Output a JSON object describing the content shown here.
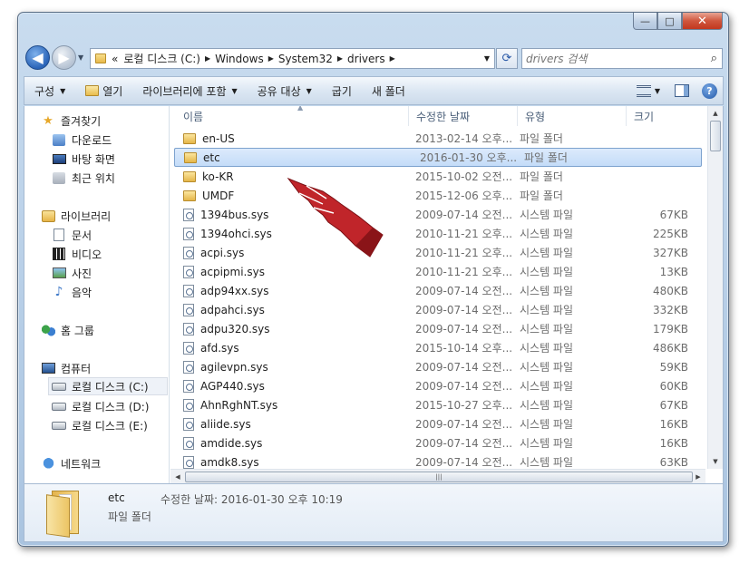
{
  "window": {
    "close_glyph": "✕",
    "minimize_glyph": "—",
    "maximize_glyph": "□"
  },
  "nav": {
    "back_glyph": "◀",
    "forward_glyph": "▶",
    "address": {
      "prefix": "«",
      "segments": [
        "로컬 디스크 (C:)",
        "Windows",
        "System32",
        "drivers"
      ]
    },
    "search_placeholder": "drivers 검색"
  },
  "toolbar": {
    "items": [
      {
        "label": "구성",
        "dropdown": true
      },
      {
        "label": "열기",
        "dropdown": false,
        "icon": "open-folder-icon"
      },
      {
        "label": "라이브러리에 포함",
        "dropdown": true
      },
      {
        "label": "공유 대상",
        "dropdown": true
      },
      {
        "label": "굽기",
        "dropdown": false
      },
      {
        "label": "새 폴더",
        "dropdown": false
      }
    ],
    "help_glyph": "?"
  },
  "sidebar": {
    "favorites": {
      "label": "즐겨찾기",
      "items": [
        "다운로드",
        "바탕 화면",
        "최근 위치"
      ]
    },
    "libraries": {
      "label": "라이브러리",
      "items": [
        "문서",
        "비디오",
        "사진",
        "음악"
      ]
    },
    "homegroup": {
      "label": "홈 그룹"
    },
    "computer": {
      "label": "컴퓨터",
      "items": [
        "로컬 디스크 (C:)",
        "로컬 디스크 (D:)",
        "로컬 디스크 (E:)"
      ],
      "selected": "로컬 디스크 (C:)"
    },
    "network": {
      "label": "네트워크"
    }
  },
  "columns": {
    "name": "이름",
    "date": "수정한 날짜",
    "type": "유형",
    "size": "크기"
  },
  "files": [
    {
      "name": "en-US",
      "date": "2013-02-14 오후...",
      "type": "파일 폴더",
      "size": "",
      "kind": "folder"
    },
    {
      "name": "etc",
      "date": "2016-01-30 오후...",
      "type": "파일 폴더",
      "size": "",
      "kind": "folder",
      "selected": true
    },
    {
      "name": "ko-KR",
      "date": "2015-10-02 오전...",
      "type": "파일 폴더",
      "size": "",
      "kind": "folder"
    },
    {
      "name": "UMDF",
      "date": "2015-12-06 오후...",
      "type": "파일 폴더",
      "size": "",
      "kind": "folder"
    },
    {
      "name": "1394bus.sys",
      "date": "2009-07-14 오전...",
      "type": "시스템 파일",
      "size": "67KB",
      "kind": "sys"
    },
    {
      "name": "1394ohci.sys",
      "date": "2010-11-21 오후...",
      "type": "시스템 파일",
      "size": "225KB",
      "kind": "sys"
    },
    {
      "name": "acpi.sys",
      "date": "2010-11-21 오후...",
      "type": "시스템 파일",
      "size": "327KB",
      "kind": "sys"
    },
    {
      "name": "acpipmi.sys",
      "date": "2010-11-21 오후...",
      "type": "시스템 파일",
      "size": "13KB",
      "kind": "sys"
    },
    {
      "name": "adp94xx.sys",
      "date": "2009-07-14 오전...",
      "type": "시스템 파일",
      "size": "480KB",
      "kind": "sys"
    },
    {
      "name": "adpahci.sys",
      "date": "2009-07-14 오전...",
      "type": "시스템 파일",
      "size": "332KB",
      "kind": "sys"
    },
    {
      "name": "adpu320.sys",
      "date": "2009-07-14 오전...",
      "type": "시스템 파일",
      "size": "179KB",
      "kind": "sys"
    },
    {
      "name": "afd.sys",
      "date": "2015-10-14 오후...",
      "type": "시스템 파일",
      "size": "486KB",
      "kind": "sys"
    },
    {
      "name": "agilevpn.sys",
      "date": "2009-07-14 오전...",
      "type": "시스템 파일",
      "size": "59KB",
      "kind": "sys"
    },
    {
      "name": "AGP440.sys",
      "date": "2009-07-14 오전...",
      "type": "시스템 파일",
      "size": "60KB",
      "kind": "sys"
    },
    {
      "name": "AhnRghNT.sys",
      "date": "2015-10-27 오후...",
      "type": "시스템 파일",
      "size": "67KB",
      "kind": "sys"
    },
    {
      "name": "aliide.sys",
      "date": "2009-07-14 오전...",
      "type": "시스템 파일",
      "size": "16KB",
      "kind": "sys"
    },
    {
      "name": "amdide.sys",
      "date": "2009-07-14 오전...",
      "type": "시스템 파일",
      "size": "16KB",
      "kind": "sys"
    },
    {
      "name": "amdk8.sys",
      "date": "2009-07-14 오전...",
      "type": "시스템 파일",
      "size": "63KB",
      "kind": "sys"
    }
  ],
  "details": {
    "name": "etc",
    "type": "파일 폴더",
    "modified_label": "수정한 날짜:",
    "modified_value": "2016-01-30 오후 10:19"
  },
  "colors": {
    "selection": "#cde2f9",
    "selection_border": "#7da2ce",
    "pointer": "#c0252a",
    "accent": "#2a64b8"
  }
}
